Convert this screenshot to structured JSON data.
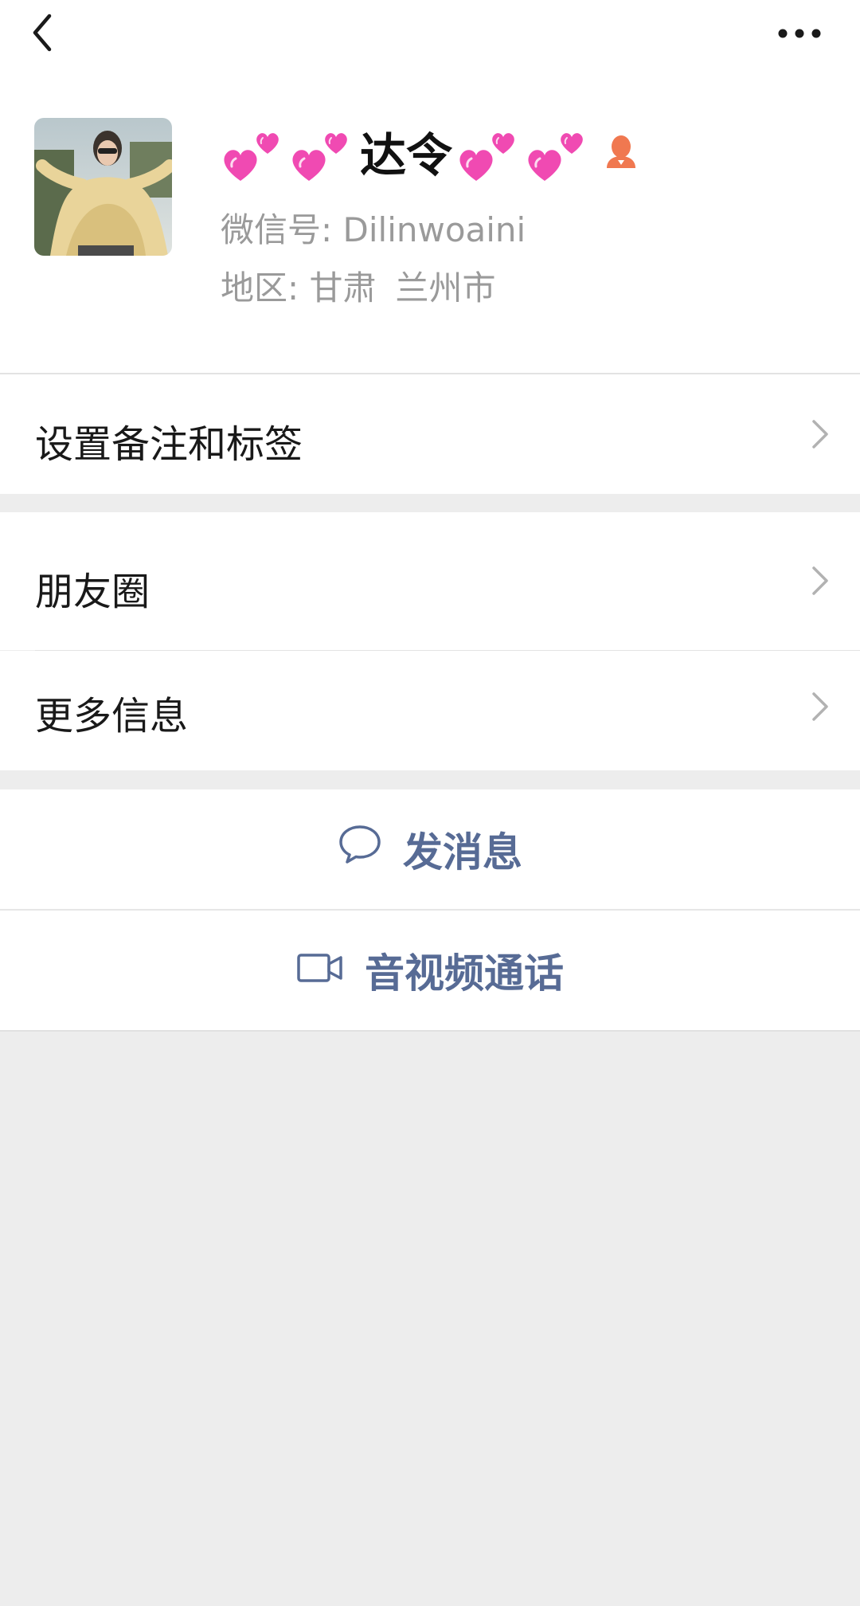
{
  "header": {
    "back_icon": "chevron-left-icon",
    "more_icon": "ellipsis-icon"
  },
  "profile": {
    "name": "达令",
    "name_decoration": "pink-heart-emoji",
    "gender_icon": "female-user-icon",
    "gender_color": "#f07850",
    "wechat_id_label": "微信号:",
    "wechat_id": "Dilinwoaini",
    "region_label": "地区:",
    "region_province": "甘肃",
    "region_city": "兰州市"
  },
  "menu": {
    "remark_label": "设置备注和标签",
    "moments_label": "朋友圈",
    "more_info_label": "更多信息"
  },
  "actions": {
    "message_label": "发消息",
    "message_icon": "chat-bubble-icon",
    "call_label": "音视频通话",
    "call_icon": "video-camera-icon",
    "accent_color": "#576b95"
  }
}
